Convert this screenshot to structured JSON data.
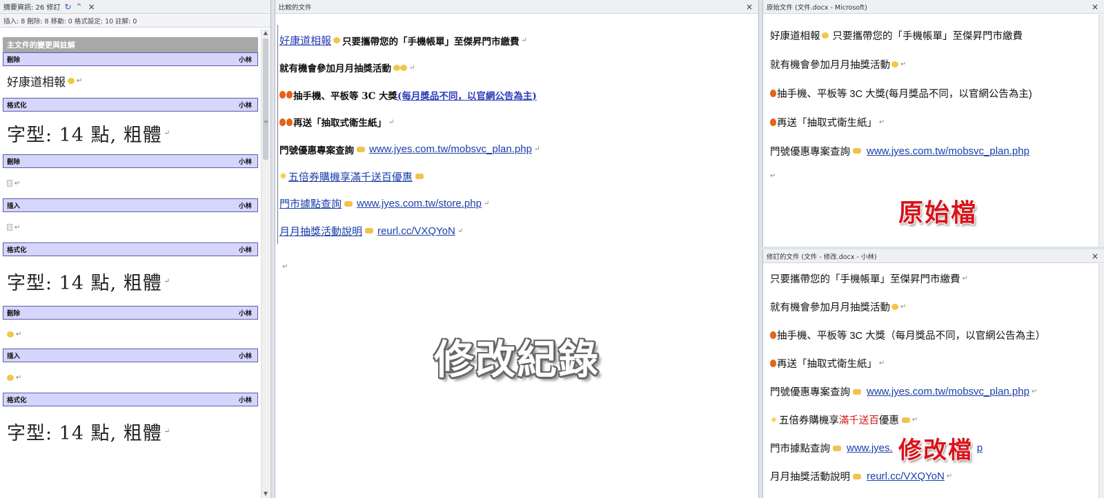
{
  "left_pane": {
    "title": "摘要資訊: 26 修訂",
    "title_icons": [
      "refresh-icon",
      "collapse-icon",
      "close-icon"
    ],
    "stats": "插入: 8 刪除: 8 移動: 0 格式設定: 10 註解: 0",
    "section_title": "主文件的變更與註解",
    "revisions": [
      {
        "type": "刪除",
        "author": "小林",
        "body": "好康道相報"
      },
      {
        "type": "格式化",
        "author": "小林",
        "body": "字型: 14 點, 粗體"
      },
      {
        "type": "刪除",
        "author": "小林",
        "body": ""
      },
      {
        "type": "插入",
        "author": "小林",
        "body": ""
      },
      {
        "type": "格式化",
        "author": "小林",
        "body": "字型: 14 點, 粗體"
      },
      {
        "type": "刪除",
        "author": "小林",
        "body": ""
      },
      {
        "type": "插入",
        "author": "小林",
        "body": ""
      },
      {
        "type": "格式化",
        "author": "小林",
        "body": "字型: 14 點, 粗體"
      }
    ]
  },
  "middle_pane": {
    "title": "比較的文件",
    "lines": [
      {
        "pre": "好康道相報",
        "text": "只要攜帶您的「手機帳單」至傑昇門市繳費"
      },
      {
        "text": "就有機會參加月月抽獎活動"
      },
      {
        "text": "抽手機、平板等 3C 大獎",
        "tail": "(每月獎品不同，以官網公告為主)"
      },
      {
        "text": "再送「抽取式衛生紙」"
      },
      {
        "text": "門號優惠專案查詢",
        "link": "www.jyes.com.tw/mobsvc_plan.php"
      },
      {
        "text": "五倍券購機享滿千送百優惠"
      },
      {
        "text": "門市據點查詢",
        "link": "www.jyes.com.tw/store.php"
      },
      {
        "text": "月月抽獎活動說明",
        "link": "reurl.cc/VXQYoN"
      }
    ],
    "overlay": "修改紀錄"
  },
  "original_pane": {
    "title": "原始文件 (文件.docx - Microsoft)",
    "lines": [
      {
        "text": "好康道相報",
        "text2": "只要攜帶您的「手機帳單」至傑昇門市繳費"
      },
      {
        "text": "就有機會參加月月抽獎活動"
      },
      {
        "text": "抽手機、平板等 3C 大獎(每月獎品不同，以官網公告為主)"
      },
      {
        "text": "再送「抽取式衛生紙」"
      },
      {
        "text": "門號優惠專案查詢",
        "link": "www.jyes.com.tw/mobsvc_plan.php"
      }
    ],
    "overlay": "原始檔"
  },
  "revised_pane": {
    "title": "修訂的文件 (文件 - 修改.docx - 小林)",
    "lines": [
      {
        "text": "只要攜帶您的「手機帳單」至傑昇門市繳費"
      },
      {
        "text": "就有機會參加月月抽獎活動"
      },
      {
        "text": "抽手機、平板等 3C 大獎（每月獎品不同，以官網公告為主）"
      },
      {
        "text": "再送「抽取式衛生紙」"
      },
      {
        "text": "門號優惠專案查詢",
        "link": "www.jyes.com.tw/mobsvc_plan.php"
      },
      {
        "text": "五倍券購機享",
        "red": "滿千送百",
        "text2": "優惠"
      },
      {
        "text": "門市據點查詢",
        "link": "www.jyes.",
        "link_tail": "p"
      },
      {
        "text": "月月抽獎活動說明",
        "link": "reurl.cc/VXQYoN"
      }
    ],
    "overlay": "修改檔"
  },
  "glyphs": {
    "para": "↵",
    "close": "×",
    "refresh": "↻",
    "collapse": "⌃",
    "star": "✷"
  }
}
